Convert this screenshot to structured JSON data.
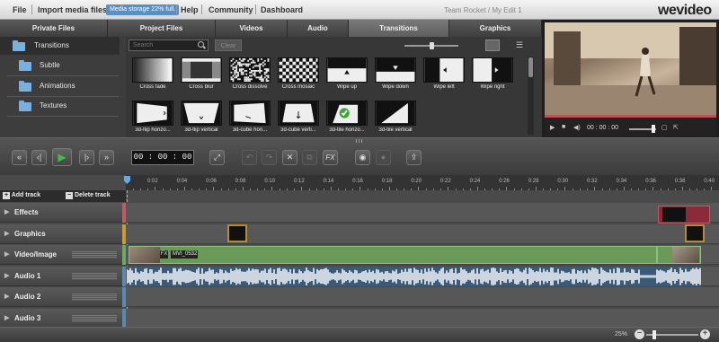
{
  "menubar": {
    "file": "File",
    "import": "Import media files",
    "storage_badge": "Media storage 22% full.",
    "help": "Help",
    "community": "Community",
    "dashboard": "Dashboard",
    "project_title": "Team Rocket / My Edit 1",
    "logo": "wevideo"
  },
  "tabs": [
    {
      "label": "Private Files"
    },
    {
      "label": "Project Files"
    },
    {
      "label": "Videos"
    },
    {
      "label": "Audio"
    },
    {
      "label": "Transitions",
      "active": true
    },
    {
      "label": "Graphics"
    }
  ],
  "tree": {
    "header": "Transitions",
    "items": [
      {
        "label": "Subtle"
      },
      {
        "label": "Animations"
      },
      {
        "label": "Textures"
      }
    ]
  },
  "search": {
    "placeholder": "Search",
    "clear_label": "Clear"
  },
  "transitions": [
    {
      "label": "Cross fade",
      "icon": "gradient"
    },
    {
      "label": "Cross blur",
      "icon": "blur"
    },
    {
      "label": "Cross dissolve",
      "icon": "noise"
    },
    {
      "label": "Cross mosaic",
      "icon": "checker"
    },
    {
      "label": "Wipe up",
      "icon": "arrow-up"
    },
    {
      "label": "Wipe down",
      "icon": "arrow-down"
    },
    {
      "label": "Wipe left",
      "icon": "arrow-left"
    },
    {
      "label": "Wipe right",
      "icon": "arrow-right"
    },
    {
      "label": "3d-flip horizo...",
      "icon": "flip-h"
    },
    {
      "label": "3d-flip vertical",
      "icon": "flip-v"
    },
    {
      "label": "3d-cube hori...",
      "icon": "cube-h"
    },
    {
      "label": "3d-cube verti...",
      "icon": "cube-v"
    },
    {
      "label": "3d-tile horizo...",
      "icon": "tile-h",
      "selected": true
    },
    {
      "label": "3d-tile vertical",
      "icon": "tile-v"
    }
  ],
  "player": {
    "time": "00 : 00 : 00"
  },
  "toolbar": {
    "timecode": "00 : 00 : 00",
    "fx_label": "FX"
  },
  "ruler": [
    "0:02",
    "0:04",
    "0:06",
    "0:08",
    "0:10",
    "0:12",
    "0:14",
    "0:16",
    "0:18",
    "0:20",
    "0:22",
    "0:24",
    "0:26",
    "0:28",
    "0:30",
    "0:32",
    "0:34",
    "0:36",
    "0:38",
    "0:40"
  ],
  "tracks": {
    "add_track": "Add track",
    "delete_track": "Delete track",
    "rows": [
      {
        "label": "Effects",
        "color": "#c05a6a"
      },
      {
        "label": "Graphics",
        "color": "#c99a3a"
      },
      {
        "label": "Video/Image",
        "color": "#6aaa5a"
      },
      {
        "label": "Audio 1",
        "color": "#5a8ab0"
      },
      {
        "label": "Audio 2",
        "color": "#5a8ab0"
      },
      {
        "label": "Audio 3",
        "color": "#5a8ab0"
      }
    ]
  },
  "clip": {
    "fx": "FX",
    "name": "MVI_0532"
  },
  "status": {
    "zoom": "25%"
  }
}
